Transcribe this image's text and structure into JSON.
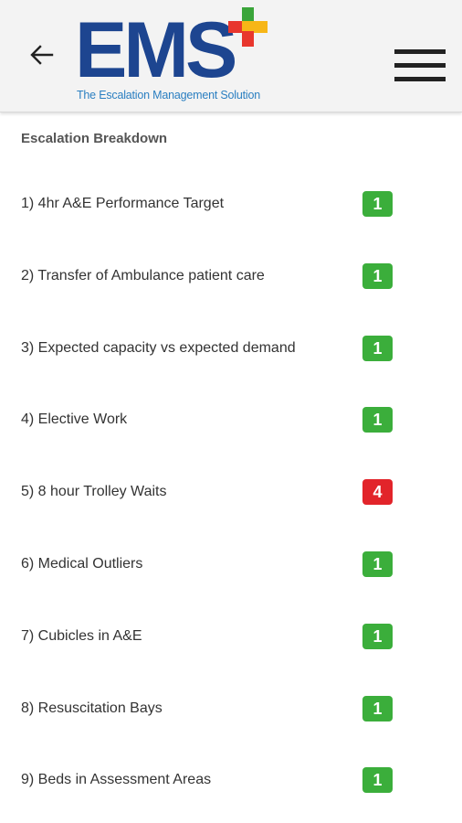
{
  "header": {
    "logo_text": "EMS",
    "logo_tagline": "The Escalation Management Solution",
    "colors": {
      "brand_blue": "#1d4590",
      "tagline_blue": "#2b7fc1",
      "plus_red": "#e8362d",
      "plus_yellow": "#f7b617",
      "plus_green": "#3aa53a"
    }
  },
  "section": {
    "title": "Escalation Breakdown"
  },
  "items": [
    {
      "label": "1) 4hr A&E Performance Target",
      "level": "1",
      "color": "#3bae3b"
    },
    {
      "label": "2) Transfer of Ambulance patient care",
      "level": "1",
      "color": "#3bae3b"
    },
    {
      "label": "3) Expected capacity vs expected demand",
      "level": "1",
      "color": "#3bae3b"
    },
    {
      "label": "4) Elective Work",
      "level": "1",
      "color": "#3bae3b"
    },
    {
      "label": "5) 8 hour Trolley Waits",
      "level": "4",
      "color": "#e2242a"
    },
    {
      "label": "6) Medical Outliers",
      "level": "1",
      "color": "#3bae3b"
    },
    {
      "label": "7) Cubicles in A&E",
      "level": "1",
      "color": "#3bae3b"
    },
    {
      "label": "8) Resuscitation Bays",
      "level": "1",
      "color": "#3bae3b"
    },
    {
      "label": "9) Beds in Assessment Areas",
      "level": "1",
      "color": "#3bae3b"
    }
  ]
}
